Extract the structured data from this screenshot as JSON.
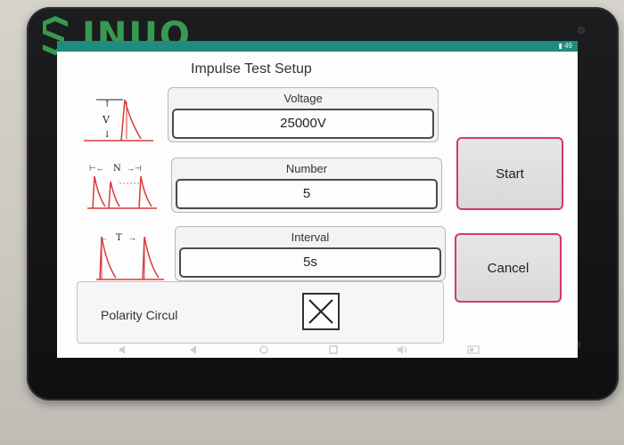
{
  "brand": {
    "name": "INUO",
    "color": "#3aa555"
  },
  "screen": {
    "title": "Impulse Test Setup",
    "accent_color": "#1e8c7e",
    "status_text": "▮ 49"
  },
  "diagrams": [
    {
      "name": "voltage-waveform-diagram",
      "label": "V"
    },
    {
      "name": "number-waveform-diagram",
      "label": "N"
    },
    {
      "name": "interval-waveform-diagram",
      "label": "T"
    }
  ],
  "fields": {
    "voltage": {
      "label": "Voltage",
      "value": "25000V"
    },
    "number": {
      "label": "Number",
      "value": "5"
    },
    "interval": {
      "label": "Interval",
      "value": "5s"
    }
  },
  "buttons": {
    "start": {
      "label": "Start"
    },
    "cancel": {
      "label": "Cancel"
    },
    "border_color": "#d23b6a"
  },
  "polarity": {
    "label": "Polarity Circul",
    "checked": true
  },
  "nav_bar": {
    "icons": [
      "volume-down-icon",
      "back-icon",
      "home-icon",
      "recents-icon",
      "volume-up-icon",
      "screenshot-icon"
    ]
  }
}
